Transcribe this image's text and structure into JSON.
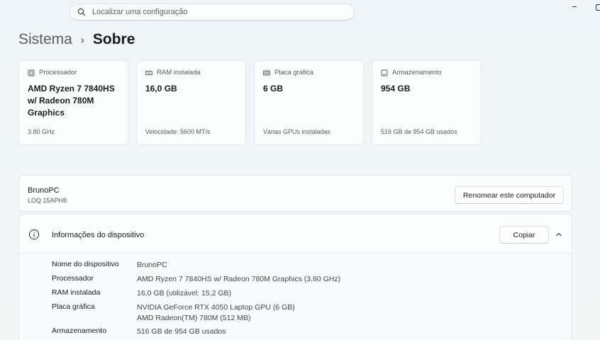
{
  "search": {
    "placeholder": "Localizar uma configuração"
  },
  "breadcrumb": {
    "parent": "Sistema",
    "separator": "›",
    "current": "Sobre"
  },
  "cards": [
    {
      "icon": "processor-icon",
      "label": "Processador",
      "value": "AMD Ryzen 7 7840HS w/ Radeon 780M Graphics",
      "sub": "3.80 GHz"
    },
    {
      "icon": "ram-icon",
      "label": "RAM instalada",
      "value": "16,0 GB",
      "sub": "Velocidade: 5600 MT/s"
    },
    {
      "icon": "gpu-icon",
      "label": "Placa gráfica",
      "value": "6 GB",
      "sub": "Várias GPUs instaladas"
    },
    {
      "icon": "storage-icon",
      "label": "Armazenamento",
      "value": "954 GB",
      "sub": "516 GB de 954 GB usados"
    }
  ],
  "pc": {
    "name": "BrunoPC",
    "model": "LOQ 15APH8",
    "rename_label": "Renomear este computador"
  },
  "device_info": {
    "title": "Informações do dispositivo",
    "copy_label": "Copiar",
    "rows": [
      {
        "label": "Nome do dispositivo",
        "value": "BrunoPC"
      },
      {
        "label": "Processador",
        "value": "AMD Ryzen 7 7840HS w/ Radeon 780M Graphics (3.80 GHz)"
      },
      {
        "label": "RAM instalada",
        "value": "16,0 GB (utilizável: 15,2 GB)"
      },
      {
        "label": "Placa gráfica",
        "value": "NVIDIA GeForce RTX 4050 Laptop GPU (6 GB)",
        "value2": "AMD Radeon(TM) 780M (512 MB)"
      },
      {
        "label": "Armazenamento",
        "value": "516 GB de 954 GB usados"
      }
    ]
  }
}
